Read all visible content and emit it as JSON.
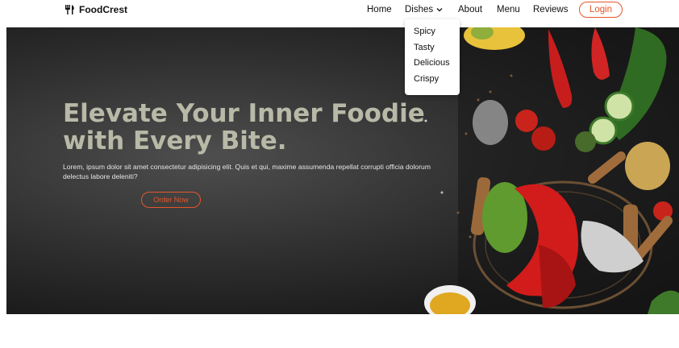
{
  "brand": {
    "name": "FoodCrest",
    "icon": "fork-knife-icon"
  },
  "nav": {
    "home": "Home",
    "dishes": "Dishes",
    "about": "About",
    "menu": "Menu",
    "reviews": "Reviews",
    "login": "Login"
  },
  "dropdown": {
    "items": [
      "Spicy",
      "Tasty",
      "Delicious",
      "Crispy"
    ]
  },
  "hero": {
    "title_line1": "Elevate Your Inner Foodie",
    "title_line2": "with Every Bite.",
    "description": "Lorem, ipsum dolor sit amet consectetur adipisicing elit. Quis et qui, maxime assumenda repellat corrupti officia dolorum delectus labore deleniti?",
    "cta": "Order Now"
  },
  "colors": {
    "accent": "#e4562a",
    "title": "#b9b9a8",
    "hero_bg": "#2a2a2a"
  }
}
